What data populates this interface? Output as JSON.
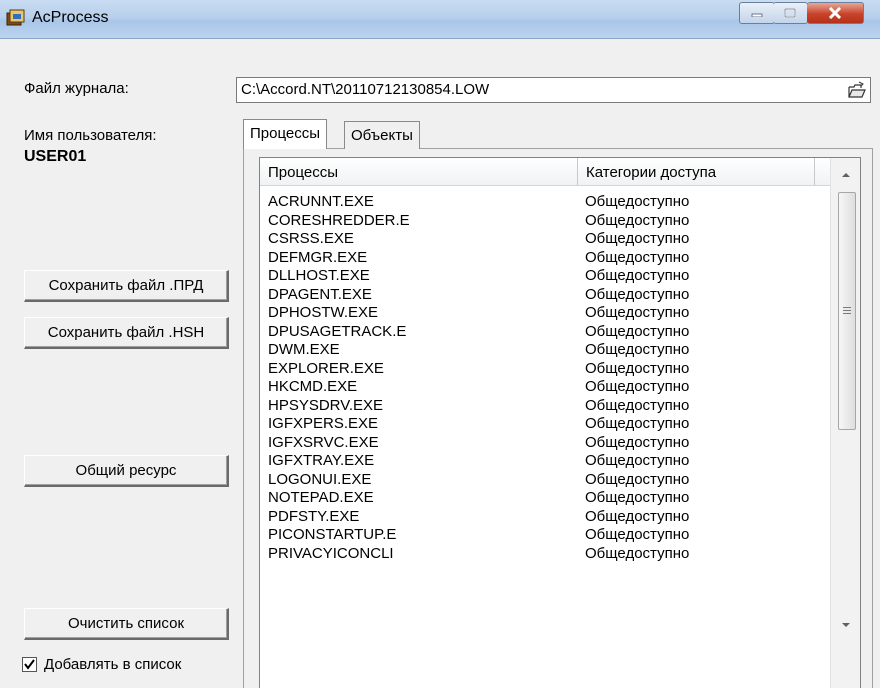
{
  "window": {
    "title": "AcProcess",
    "app_icon": "acprocess-app-icon",
    "controls": [
      "minimize-icon",
      "maximize-icon",
      "close-icon"
    ]
  },
  "log_file": {
    "label": "Файл журнала:",
    "value": "C:\\Accord.NT\\20110712130854.LOW",
    "browse_icon": "open-folder-icon"
  },
  "user": {
    "label": "Имя пользователя:",
    "value": "USER01"
  },
  "buttons": {
    "save_prd": "Сохранить файл .ПРД",
    "save_hsh": "Сохранить файл .HSH",
    "shared": "Общий ресурс",
    "clear": "Очистить список"
  },
  "add_to_list": {
    "label": "Добавлять в список",
    "checked": true
  },
  "tabs": [
    {
      "label": "Процессы",
      "active": true
    },
    {
      "label": "Объекты",
      "active": false
    }
  ],
  "table": {
    "columns": [
      "Процессы",
      "Категории доступа"
    ],
    "rows": [
      [
        "ACRUNNT.EXE",
        "Общедоступно"
      ],
      [
        "CORESHREDDER.E",
        "Общедоступно"
      ],
      [
        "CSRSS.EXE",
        "Общедоступно"
      ],
      [
        "DEFMGR.EXE",
        "Общедоступно"
      ],
      [
        "DLLHOST.EXE",
        "Общедоступно"
      ],
      [
        "DPAGENT.EXE",
        "Общедоступно"
      ],
      [
        "DPHOSTW.EXE",
        "Общедоступно"
      ],
      [
        "DPUSAGETRACK.E",
        "Общедоступно"
      ],
      [
        "DWM.EXE",
        "Общедоступно"
      ],
      [
        "EXPLORER.EXE",
        "Общедоступно"
      ],
      [
        "HKCMD.EXE",
        "Общедоступно"
      ],
      [
        "HPSYSDRV.EXE",
        "Общедоступно"
      ],
      [
        "IGFXPERS.EXE",
        "Общедоступно"
      ],
      [
        "IGFXSRVC.EXE",
        "Общедоступно"
      ],
      [
        "IGFXTRAY.EXE",
        "Общедоступно"
      ],
      [
        "LOGONUI.EXE",
        "Общедоступно"
      ],
      [
        "NOTEPAD.EXE",
        "Общедоступно"
      ],
      [
        "PDFSTY.EXE",
        "Общедоступно"
      ],
      [
        "PICONSTARTUP.E",
        "Общедоступно"
      ],
      [
        "PRIVACYICONCLI",
        "Общедоступно"
      ]
    ]
  },
  "scrollbar_icons": [
    "scroll-up-arrow-icon",
    "scroll-down-arrow-icon"
  ]
}
